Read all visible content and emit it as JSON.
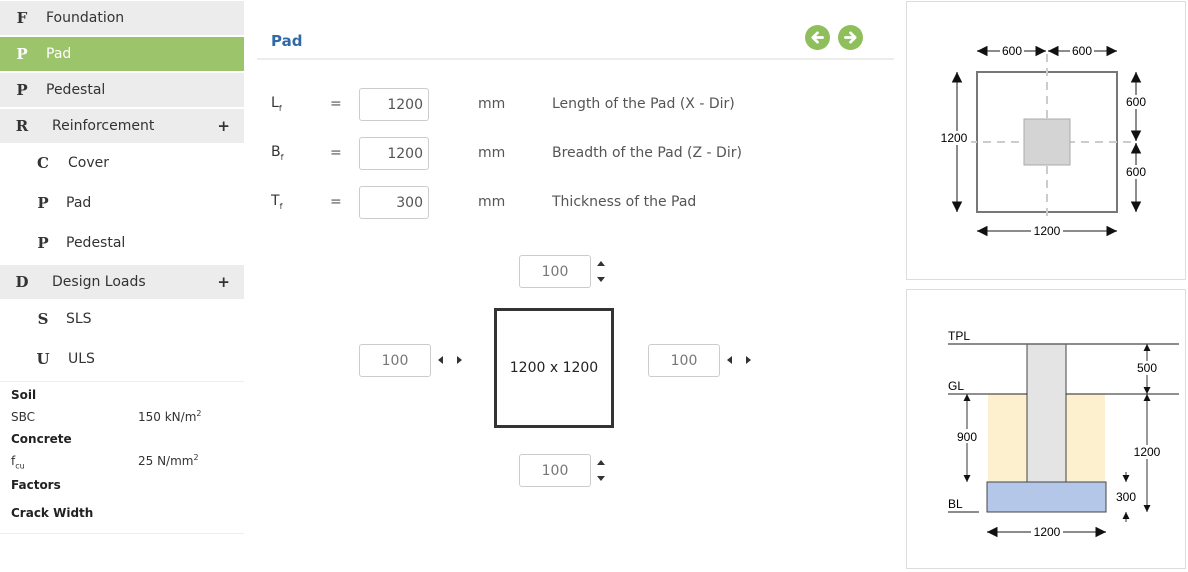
{
  "sidebar": {
    "items": [
      {
        "letter": "F",
        "label": "Foundation"
      },
      {
        "letter": "P",
        "label": "Pad"
      },
      {
        "letter": "P",
        "label": "Pedestal"
      },
      {
        "letter": "R",
        "label": "Reinforcement",
        "expand": "+"
      },
      {
        "letter": "C",
        "label": "Cover"
      },
      {
        "letter": "P",
        "label": "Pad"
      },
      {
        "letter": "P",
        "label": "Pedestal"
      },
      {
        "letter": "D",
        "label": "Design Loads",
        "expand": "+"
      },
      {
        "letter": "S",
        "label": "SLS"
      },
      {
        "letter": "U",
        "label": "ULS"
      }
    ],
    "summary": {
      "soil_label": "Soil",
      "sbc_label": "SBC",
      "sbc_value": "150 kN/m",
      "sbc_sup": "2",
      "concrete_label": "Concrete",
      "fcu_label": "f",
      "fcu_sub": "cu",
      "fcu_value": "25 N/mm",
      "fcu_sup": "2",
      "factors_label": "Factors",
      "crack_label": "Crack Width"
    }
  },
  "main": {
    "title": "Pad",
    "colors": {
      "accent": "#9bc46b",
      "title": "#2f6aa6"
    },
    "params": [
      {
        "sym": "L",
        "sub": "f",
        "eq": "=",
        "value": "1200",
        "unit": "mm",
        "desc": "Length of the Pad (X - Dir)"
      },
      {
        "sym": "B",
        "sub": "f",
        "eq": "=",
        "value": "1200",
        "unit": "mm",
        "desc": "Breadth of the Pad (Z - Dir)"
      },
      {
        "sym": "T",
        "sub": "f",
        "eq": "=",
        "value": "300",
        "unit": "mm",
        "desc": "Thickness of the Pad"
      }
    ],
    "offsets": {
      "top": "100",
      "left": "100",
      "right": "100",
      "bottom": "100"
    },
    "pad_size": "1200 x 1200"
  },
  "plan_diagram": {
    "top_left": "600",
    "top_right": "600",
    "left_total": "1200",
    "right_top": "600",
    "right_bottom": "600",
    "bottom_total": "1200"
  },
  "section_diagram": {
    "tpl": "TPL",
    "gl": "GL",
    "bl": "BL",
    "pedestal_above_gl": "500",
    "depth_to_pad": "900",
    "total_depth": "1200",
    "pad_thickness": "300",
    "pad_width": "1200",
    "colors": {
      "soil": "#fdf0cf",
      "pedestal": "#e4e4e4",
      "pad": "#b5c7e8"
    }
  }
}
